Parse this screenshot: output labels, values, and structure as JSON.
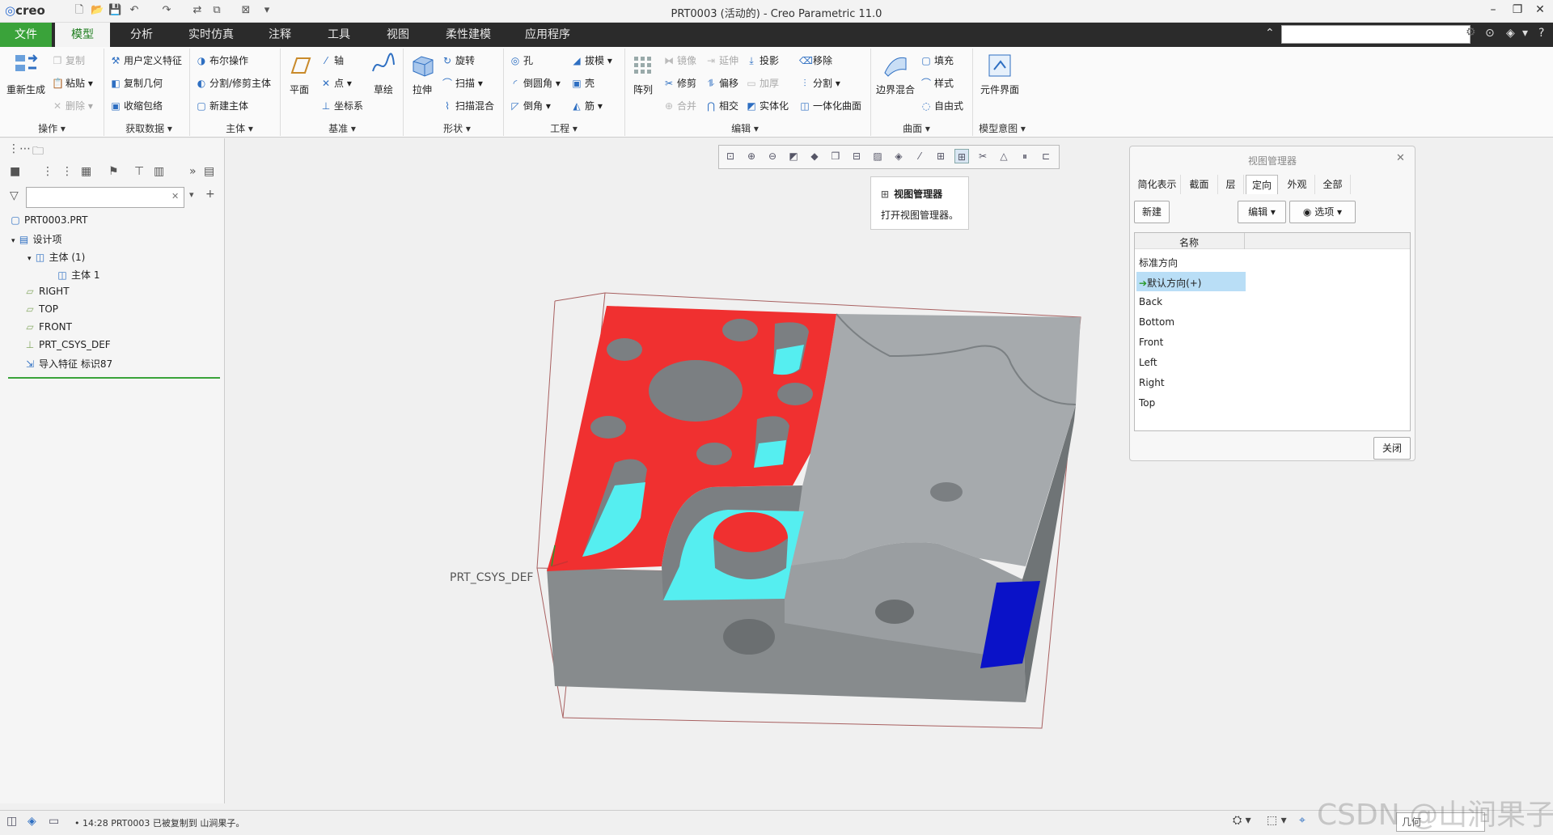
{
  "app": {
    "logo": "creo",
    "window_title": "PRT0003 (活动的) - Creo Parametric 11.0"
  },
  "menu": {
    "items": [
      "文件",
      "模型",
      "分析",
      "实时仿真",
      "注释",
      "工具",
      "视图",
      "柔性建模",
      "应用程序"
    ],
    "active": "模型"
  },
  "ribbon": {
    "operations": {
      "regenerate": "重新生成",
      "copy": "复制",
      "paste": "粘贴",
      "delete": "删除",
      "group": "操作"
    },
    "get_data": {
      "udf": "用户定义特征",
      "copy_geom": "复制几何",
      "shrinkwrap": "收缩包络",
      "group": "获取数据"
    },
    "body": {
      "boolean": "布尔操作",
      "split_trim": "分割/修剪主体",
      "new_body": "新建主体",
      "group": "主体"
    },
    "datum": {
      "plane": "平面",
      "axis": "轴",
      "point": "点",
      "csys": "坐标系",
      "sketch": "草绘",
      "group": "基准"
    },
    "shapes": {
      "extrude": "拉伸",
      "revolve": "旋转",
      "sweep": "扫描",
      "swept_blend": "扫描混合",
      "group": "形状"
    },
    "engineering": {
      "hole": "孔",
      "round": "倒圆角",
      "chamfer": "倒角",
      "draft": "拔模",
      "shell": "壳",
      "rib": "筋",
      "group": "工程"
    },
    "editing": {
      "pattern": "阵列",
      "mirror": "镜像",
      "extend": "延伸",
      "project": "投影",
      "remove": "移除",
      "trim": "修剪",
      "offset": "偏移",
      "thicken": "加厚",
      "split": "分割",
      "merge": "合并",
      "intersect": "相交",
      "solidify": "实体化",
      "unify_surface": "一体化曲面",
      "group": "编辑"
    },
    "surfaces": {
      "boundary_blend": "边界混合",
      "fill": "填充",
      "style": "样式",
      "freestyle": "自由式",
      "group": "曲面"
    },
    "model_intent": {
      "component_interface": "元件界面",
      "group": "模型意图"
    }
  },
  "tree": {
    "root": "PRT0003.PRT",
    "items": [
      "设计项",
      "主体 (1)",
      "主体 1",
      "RIGHT",
      "TOP",
      "FRONT",
      "PRT_CSYS_DEF",
      "导入特征 标识87"
    ]
  },
  "graphics": {
    "csys_label": "PRT_CSYS_DEF",
    "tooltip_title": "视图管理器",
    "tooltip_text": "打开视图管理器。"
  },
  "view_manager": {
    "title": "视图管理器",
    "tabs": [
      "简化表示",
      "截面",
      "层",
      "定向",
      "外观",
      "全部"
    ],
    "active_tab": "定向",
    "new_btn": "新建",
    "edit_btn": "编辑",
    "options_btn": "选项",
    "col_name": "名称",
    "rows": [
      "标准方向",
      "默认方向(+)",
      "Back",
      "Bottom",
      "Front",
      "Left",
      "Right",
      "Top"
    ],
    "selected_row": "默认方向(+)",
    "close_btn": "关闭"
  },
  "status": {
    "message": "14:28 PRT0003 已被复制到 山涧果子。",
    "filter": "几何"
  },
  "watermark": "CSDN @山涧果子",
  "colors": {
    "menu_bg": "#2b2b2b",
    "file_tab": "#3aa33a",
    "face_red": "#f03030",
    "face_cyan": "#55eef0",
    "face_blue": "#0a12c8",
    "body_gray": "#8c9092"
  }
}
